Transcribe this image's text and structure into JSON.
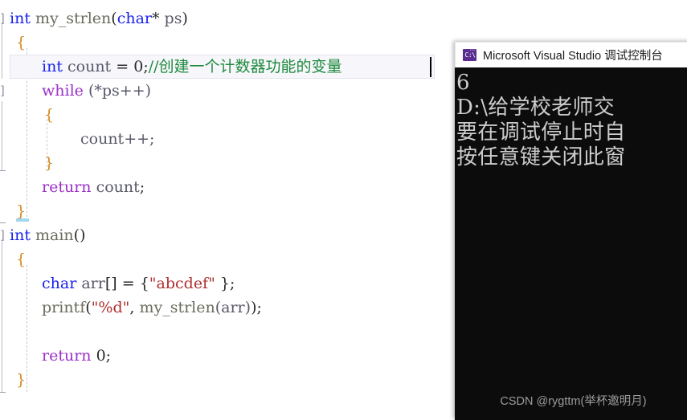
{
  "editor": {
    "background": "#ffffff",
    "current_line_comment_color": "#1f8a3d",
    "lines": [
      {
        "indent": 0,
        "text": "int my_strlen(char* ps)"
      },
      {
        "indent": 1,
        "text": "{"
      },
      {
        "indent": 2,
        "text": "int count = 0;//创建一个计数器功能的变量"
      },
      {
        "indent": 2,
        "text": "while (*ps++)"
      },
      {
        "indent": 2,
        "text": "{"
      },
      {
        "indent": 3,
        "text": "count++;"
      },
      {
        "indent": 2,
        "text": "}"
      },
      {
        "indent": 2,
        "text": "return count;"
      },
      {
        "indent": 1,
        "text": "}"
      },
      {
        "indent": 0,
        "text": "int main()"
      },
      {
        "indent": 1,
        "text": "{"
      },
      {
        "indent": 2,
        "text": "char arr[] = {\"abcdef\" };"
      },
      {
        "indent": 2,
        "text": "printf(\"%d\", my_strlen(arr));"
      },
      {
        "indent": 2,
        "text": ""
      },
      {
        "indent": 2,
        "text": "return 0;"
      },
      {
        "indent": 1,
        "text": "}"
      }
    ],
    "tokens": {
      "line1": {
        "kw": "int",
        "name": "my_strlen",
        "open": "(",
        "type": "char",
        "star": "*",
        "param": "ps",
        "close": ")"
      },
      "line3": {
        "kw": "int",
        "name": "count",
        "eq": "=",
        "value": "0",
        "semi": ";",
        "comment": "//创建一个计数器功能的变量"
      },
      "line4": {
        "kw": "while",
        "expr": "(*ps++)"
      },
      "line6": {
        "stmt": "count++;"
      },
      "line8": {
        "kw": "return",
        "value": "count",
        "semi": ";"
      },
      "line10": {
        "kw": "int",
        "name": "main",
        "parens": "()"
      },
      "line12": {
        "kw": "char",
        "name": "arr",
        "brackets": "[]",
        "eq": "=",
        "open": "{",
        "string": "\"abcdef\"",
        "close": " };"
      },
      "line13": {
        "name": "printf",
        "open": "(",
        "fmt": "\"%d\"",
        "comma": ",",
        "call": "my_strlen",
        "arg": "(arr)",
        "close": ");"
      },
      "line15": {
        "kw": "return",
        "value": "0",
        "semi": ";"
      }
    },
    "brace_char": "{",
    "brace_close_char": "}"
  },
  "console": {
    "title": "Microsoft Visual Studio 调试控制台",
    "icon": "command-prompt-icon",
    "icon_prompt_text": "C:\\",
    "background": "#0c0c0c",
    "text_color": "#cccccc",
    "lines": [
      "6",
      "D:\\给学校老师交",
      "要在调试停止时自",
      "按任意键关闭此窗"
    ],
    "watermark": "CSDN @rygttm(举杯邀明月)"
  }
}
